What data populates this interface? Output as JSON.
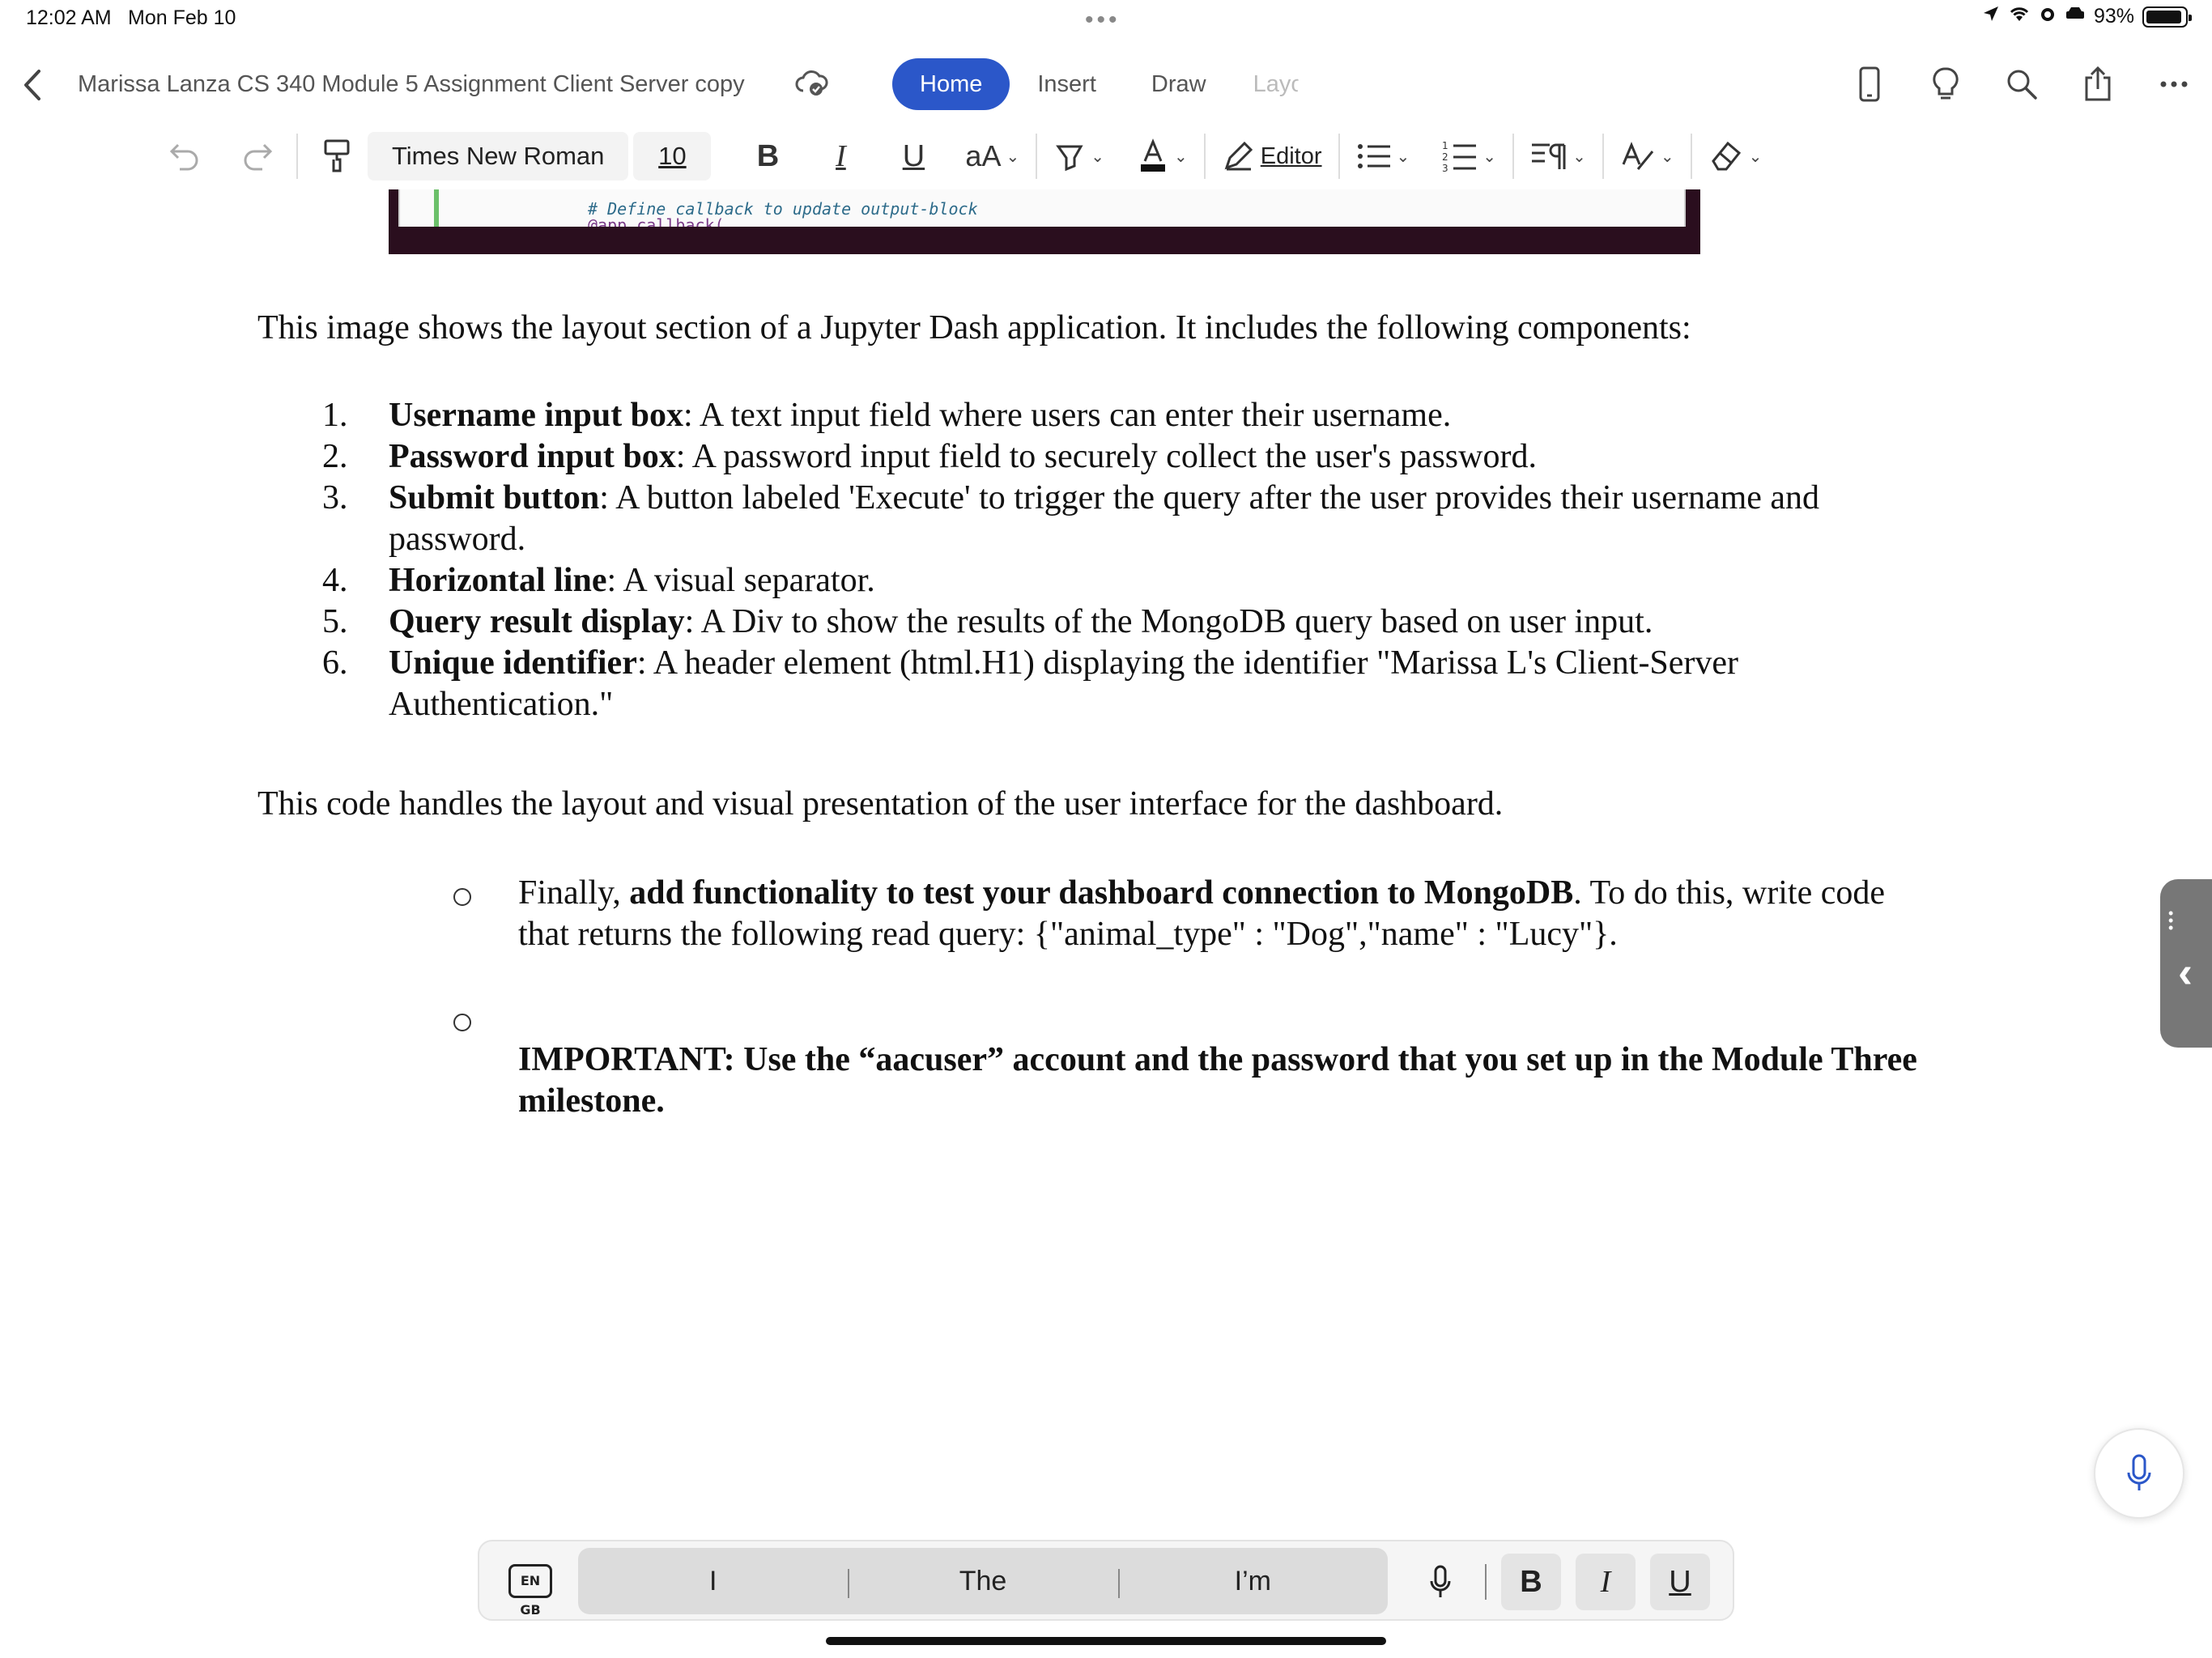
{
  "status": {
    "time": "12:02 AM",
    "date": "Mon Feb 10",
    "battery": "93%",
    "battery_level": 0.93
  },
  "header": {
    "doc_title": "Marissa Lanza CS 340 Module 5 Assignment Client Server copy",
    "tabs": [
      "Home",
      "Insert",
      "Draw",
      "Layo"
    ]
  },
  "ribbon": {
    "font_name": "Times New Roman",
    "font_size": "10",
    "bold": "B",
    "italic": "I",
    "underline": "U",
    "case": "aA",
    "editor": "Editor"
  },
  "document": {
    "image_code_line": "# Define callback to update output-block",
    "image_code_line2": "@app.callback(",
    "intro": "This image shows the layout section of a Jupyter Dash application. It includes the following components:",
    "items": [
      {
        "num": "1.",
        "term": "Username input box",
        "desc": ": A text input field where users can enter their username."
      },
      {
        "num": "2.",
        "term": "Password input box",
        "desc": ": A password input field to securely collect the user's password."
      },
      {
        "num": "3.",
        "term": "Submit button",
        "desc": ": A button labeled 'Execute' to trigger the query after the user provides their username and password."
      },
      {
        "num": "4.",
        "term": "Horizontal line",
        "desc": ": A visual separator."
      },
      {
        "num": "5.",
        "term": "Query result display",
        "desc": ": A Div to show the results of the MongoDB query based on user input."
      },
      {
        "num": "6.",
        "term": "Unique identifier",
        "desc": ": A header element (html.H1) displaying the identifier \"Marissa L's Client-Server Authentication.\""
      }
    ],
    "summary": "This code handles the layout and visual presentation of the user interface for the dashboard.",
    "bullet1_pre": "Finally, ",
    "bullet1_bold": "add functionality to test your dashboard connection to MongoDB",
    "bullet1_post": ". To do this, write code that returns the following read query: {\"animal_type\" : \"Dog\",\"name\" : \"Lucy\"}.",
    "bullet2_bold": "IMPORTANT: Use the “aacuser” account and the password that you set up in the Module Three milestone."
  },
  "keyboard": {
    "language": "EN GB",
    "suggestions": [
      "I",
      "The",
      "I’m"
    ],
    "bold": "B",
    "italic": "I",
    "underline": "U"
  }
}
